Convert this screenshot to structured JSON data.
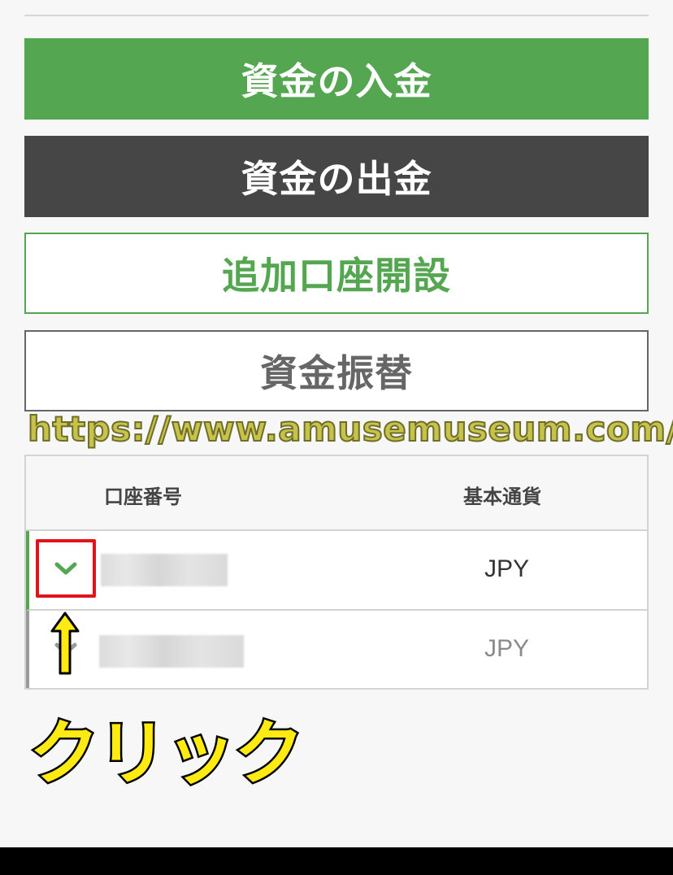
{
  "actions": {
    "deposit_label": "資金の入金",
    "withdraw_label": "資金の出金",
    "open_account_label": "追加口座開設",
    "transfer_label": "資金振替"
  },
  "watermark": "https://www.amusemuseum.com/",
  "accounts_table": {
    "headers": {
      "account_number": "口座番号",
      "base_currency": "基本通貨"
    },
    "rows": [
      {
        "account_number": "",
        "currency": "JPY",
        "expanded": false,
        "highlighted": true
      },
      {
        "account_number": "",
        "currency": "JPY",
        "expanded": false,
        "highlighted": false
      }
    ]
  },
  "annotation": {
    "click_label": "クリック"
  },
  "colors": {
    "green": "#55a651",
    "dark": "#464646",
    "highlight_red": "#e0141a",
    "annotation_yellow": "#ffeb12"
  }
}
